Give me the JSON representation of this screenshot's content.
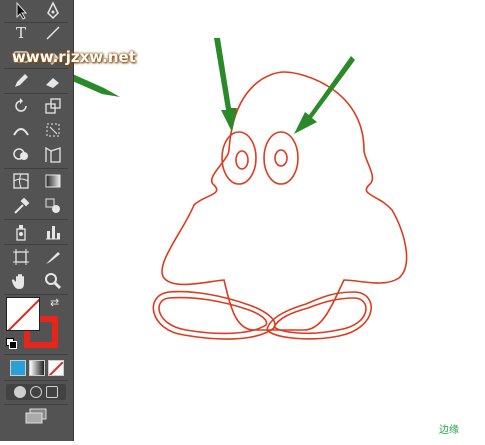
{
  "toolbar": {
    "tools": [
      {
        "name": "selection-tool"
      },
      {
        "name": "pen-tool"
      },
      {
        "name": "type-tool",
        "glyph": "T"
      },
      {
        "name": "line-segment-tool"
      },
      {
        "name": "ellipse-tool"
      },
      {
        "name": "eraser-tool"
      },
      {
        "name": "pencil-tool"
      },
      {
        "name": "blob-brush-tool"
      },
      {
        "name": "rotate-tool"
      },
      {
        "name": "scale-tool"
      },
      {
        "name": "width-tool"
      },
      {
        "name": "free-transform-tool"
      },
      {
        "name": "shape-builder-tool"
      },
      {
        "name": "perspective-grid-tool"
      },
      {
        "name": "mesh-tool"
      },
      {
        "name": "gradient-tool"
      },
      {
        "name": "eyedropper-tool"
      },
      {
        "name": "blend-tool"
      },
      {
        "name": "symbol-sprayer-tool"
      },
      {
        "name": "column-graph-tool"
      },
      {
        "name": "artboard-tool"
      },
      {
        "name": "slice-tool"
      },
      {
        "name": "hand-tool"
      },
      {
        "name": "zoom-tool"
      }
    ],
    "fill_color": "#ffffff",
    "stroke_color": "#e8251b",
    "swatch_colors": [
      "#2aa0d8",
      "#888888",
      "#ffffff"
    ]
  },
  "watermark": "www.rjzxw.net",
  "smart_guide_label": "边缘",
  "artwork": {
    "stroke_color": "#e03a1e",
    "arrow_color": "#2a8a2a"
  }
}
